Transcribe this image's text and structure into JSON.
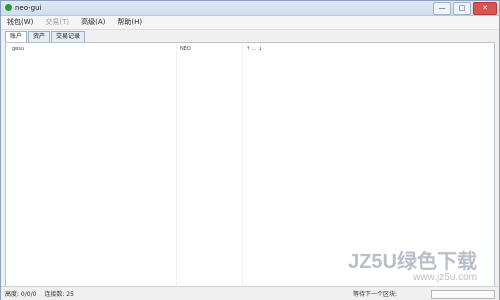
{
  "window": {
    "title": "neo-gui",
    "controls": {
      "minimize": "—",
      "maximize": "□",
      "close": "✕"
    }
  },
  "menu": [
    {
      "label": "钱包(W)",
      "enabled": true
    },
    {
      "label": "交易(T)",
      "enabled": false
    },
    {
      "label": "高级(A)",
      "enabled": true
    },
    {
      "label": "帮助(H)",
      "enabled": true
    }
  ],
  "tabs": [
    "账户",
    "资产",
    "交易记录"
  ],
  "table": {
    "row": [
      "gesu",
      "NEO",
      "↑ ... ↓"
    ]
  },
  "watermark": {
    "line1": "JZ5U绿色下载",
    "line2": "www.jz5u.com"
  },
  "status": {
    "height": "高度: 0/0/0",
    "connected": "连接数: 25",
    "waiting": "等待下一个区块:"
  },
  "colors": {
    "close_button": "#d9534f",
    "app_icon": "#2c9a3a"
  }
}
